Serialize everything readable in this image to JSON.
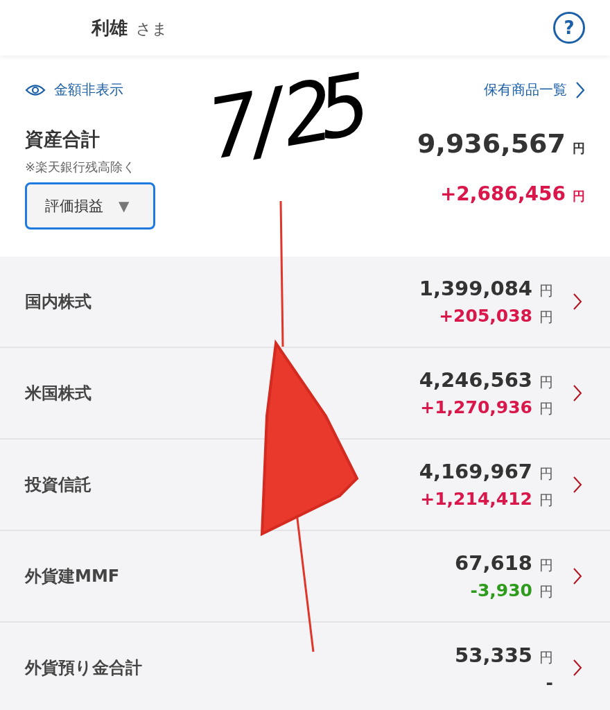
{
  "header": {
    "name": "利雄",
    "honorific": "さま",
    "help": "?"
  },
  "summary": {
    "hide_link": "金額非表示",
    "holdings_link": "保有商品一覧",
    "title": "資産合計",
    "note": "※楽天銀行残高除く",
    "dropdown": "評価損益",
    "dropdown_caret": "▼",
    "total": "9,936,567",
    "total_unit": "円",
    "gain": {
      "text": "+2,686,456",
      "unit": "円",
      "color": "#d9174a"
    }
  },
  "rows": [
    {
      "name": "国内株式",
      "value": "1,399,084",
      "unit": "円",
      "gain": "+205,038",
      "gain_unit": "円",
      "color": "#d9174a"
    },
    {
      "name": "米国株式",
      "value": "4,246,563",
      "unit": "円",
      "gain": "+1,270,936",
      "gain_unit": "円",
      "color": "#d9174a"
    },
    {
      "name": "投資信託",
      "value": "4,169,967",
      "unit": "円",
      "gain": "+1,214,412",
      "gain_unit": "円",
      "color": "#d9174a"
    },
    {
      "name": "外貨建MMF",
      "value": "67,618",
      "unit": "円",
      "gain": "-3,930",
      "gain_unit": "円",
      "color": "#2e9b1c"
    },
    {
      "name": "外貨預り金合計",
      "value": "53,335",
      "unit": "円",
      "gain": "-",
      "color": "#333333"
    }
  ],
  "annotation": {
    "text": "7/25"
  }
}
